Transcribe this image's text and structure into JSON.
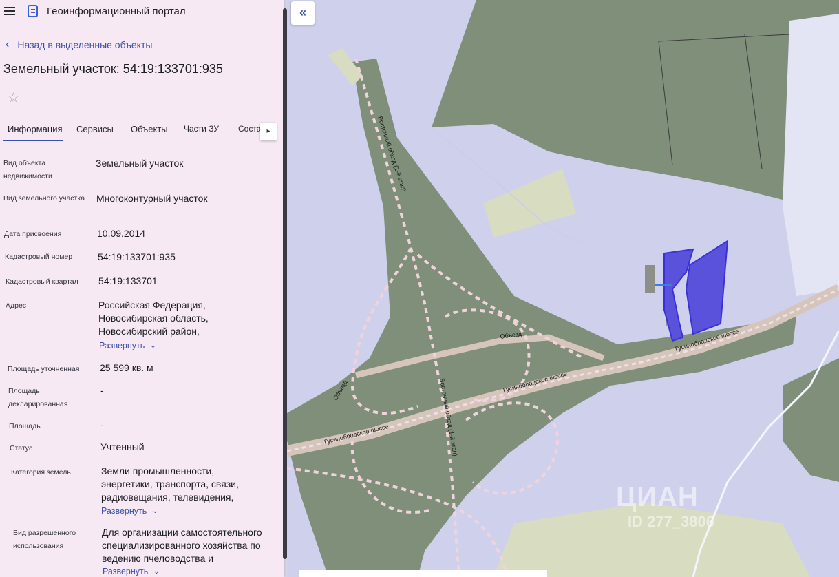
{
  "header": {
    "portal_title": "Геоинформационный портал"
  },
  "nav": {
    "back_label": "Назад в выделенные объекты"
  },
  "object": {
    "title": "Земельный участок: 54:19:133701:935"
  },
  "tabs": [
    {
      "label": "Информация",
      "active": true
    },
    {
      "label": "Сервисы"
    },
    {
      "label": "Объекты"
    },
    {
      "label": "Части ЗУ"
    },
    {
      "label": "Соста"
    }
  ],
  "fields": [
    {
      "label": "Вид объекта недвижимости",
      "value": "Земельный участок"
    },
    {
      "label": "Вид земельного участка",
      "value": "Многоконтурный участок"
    },
    {
      "label": "Дата присвоения",
      "value": "10.09.2014"
    },
    {
      "label": "Кадастровый номер",
      "value": "54:19:133701:935"
    },
    {
      "label": "Кадастровый квартал",
      "value": "54:19:133701"
    },
    {
      "label": "Адрес",
      "value": "Российская Федерация, Новосибирская область, Новосибирский район,",
      "expand": "Развернуть"
    },
    {
      "label": "Площадь уточненная",
      "value": "25 599 кв. м"
    },
    {
      "label": "Площадь декларированная",
      "value": "-"
    },
    {
      "label": "Площадь",
      "value": "-"
    },
    {
      "label": "Статус",
      "value": "Учтенный"
    },
    {
      "label": "Категория земель",
      "value": "Земли промышленности, энергетики, транспорта, связи, радиовещания, телевидения,",
      "expand": "Развернуть"
    },
    {
      "label": "Вид разрешенного использования",
      "value": "Для организации самостоятельного специализированного хозяйства по ведению пчеловодства и",
      "expand": "Развернуть"
    }
  ],
  "map": {
    "collapse_icon": "«",
    "road_labels": {
      "bypass_north": "Восточный обход (1-й этап)",
      "bypass_south": "Восточный обход (1-й этап)",
      "detour": "Объезд",
      "detour_west": "Объезд",
      "highway_east": "Гусинобродское шоссе",
      "highway_mid": "Гусинобродское шоссе",
      "highway_west": "Гусинобродское шоссе"
    },
    "watermark": "ЦИАН",
    "watermark_id": "ID 277_3806",
    "colors": {
      "forest": "#7f8f79",
      "water_area": "#c7cbe9",
      "parcel": "#5b52dc",
      "field": "#d8dcc0"
    }
  }
}
